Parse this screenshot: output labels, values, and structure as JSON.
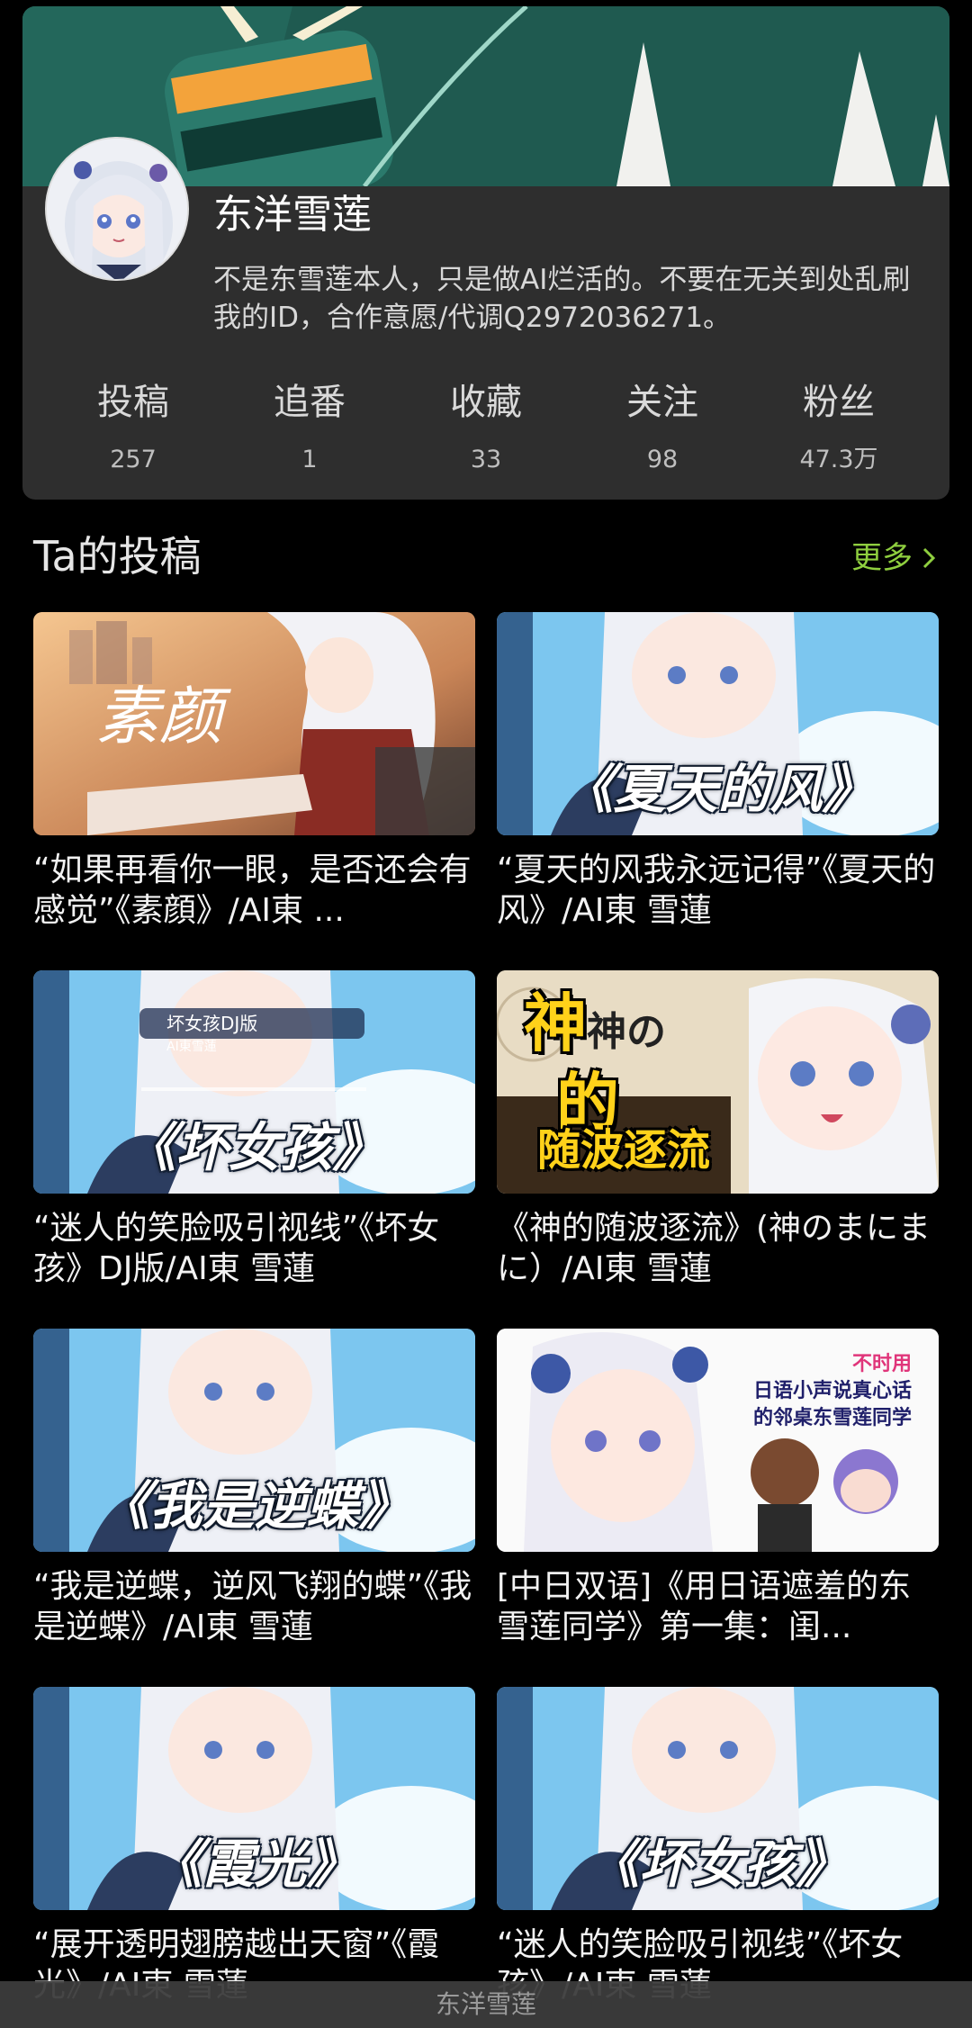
{
  "profile": {
    "username": "东洋雪莲",
    "bio": "不是东雪莲本人，只是做AI烂活的。不要在无关到处乱刷我的ID，合作意愿/代调Q2972036271。",
    "stats": [
      {
        "label": "投稿",
        "value": "257"
      },
      {
        "label": "追番",
        "value": "1"
      },
      {
        "label": "收藏",
        "value": "33"
      },
      {
        "label": "关注",
        "value": "98"
      },
      {
        "label": "粉丝",
        "value": "47.3万"
      }
    ]
  },
  "section": {
    "title": "Ta的投稿",
    "more_label": "更多",
    "more_icon": "chevron-right-icon"
  },
  "videos": [
    {
      "title": "“如果再看你一眼，是否还会有感觉”《素顔》/AI東 ...",
      "thumb_text": "素颜"
    },
    {
      "title": "“夏天的风我永远记得”《夏天的风》/AI東 雪蓮",
      "thumb_text": "《夏天的风》"
    },
    {
      "title": "“迷人的笑脸吸引视线”《坏女孩》DJ版/AI東 雪蓮",
      "thumb_text": "《坏女孩》",
      "overlay_title": "坏女孩DJ版",
      "overlay_sub": "AI東雪蓮"
    },
    {
      "title": "《神的随波逐流》(神のまにまに）/AI東 雪蓮",
      "thumb_text_top": "神の",
      "thumb_text_mid": "的",
      "thumb_text_bottom": "随波逐流",
      "thumb_text_god": "神"
    },
    {
      "title": "“我是逆蝶，逆风飞翔的蝶”《我是逆蝶》/AI東 雪蓮",
      "thumb_text": "《我是逆蝶》"
    },
    {
      "title": "[中日双语]《用日语遮羞的东雪莲同学》第一集：闺...",
      "thumb_label_1": "不时用",
      "thumb_label_2": "日语小声说真心话",
      "thumb_label_3": "的邻桌东雪莲同学"
    },
    {
      "title": "“展开透明翅膀越出天窗”《霞光》/AI東 雪蓮",
      "thumb_text": "《霞光》"
    },
    {
      "title": "“迷人的笑脸吸引视线”《坏女孩》/AI東 雪蓮",
      "thumb_text": "《坏女孩》"
    }
  ],
  "bottom_bar": {
    "title": "东洋雪莲"
  },
  "colors": {
    "background": "#000000",
    "card": "#2e2e2e",
    "accent_green": "#8fcf3f",
    "banner_teal": "#1f5a50"
  }
}
